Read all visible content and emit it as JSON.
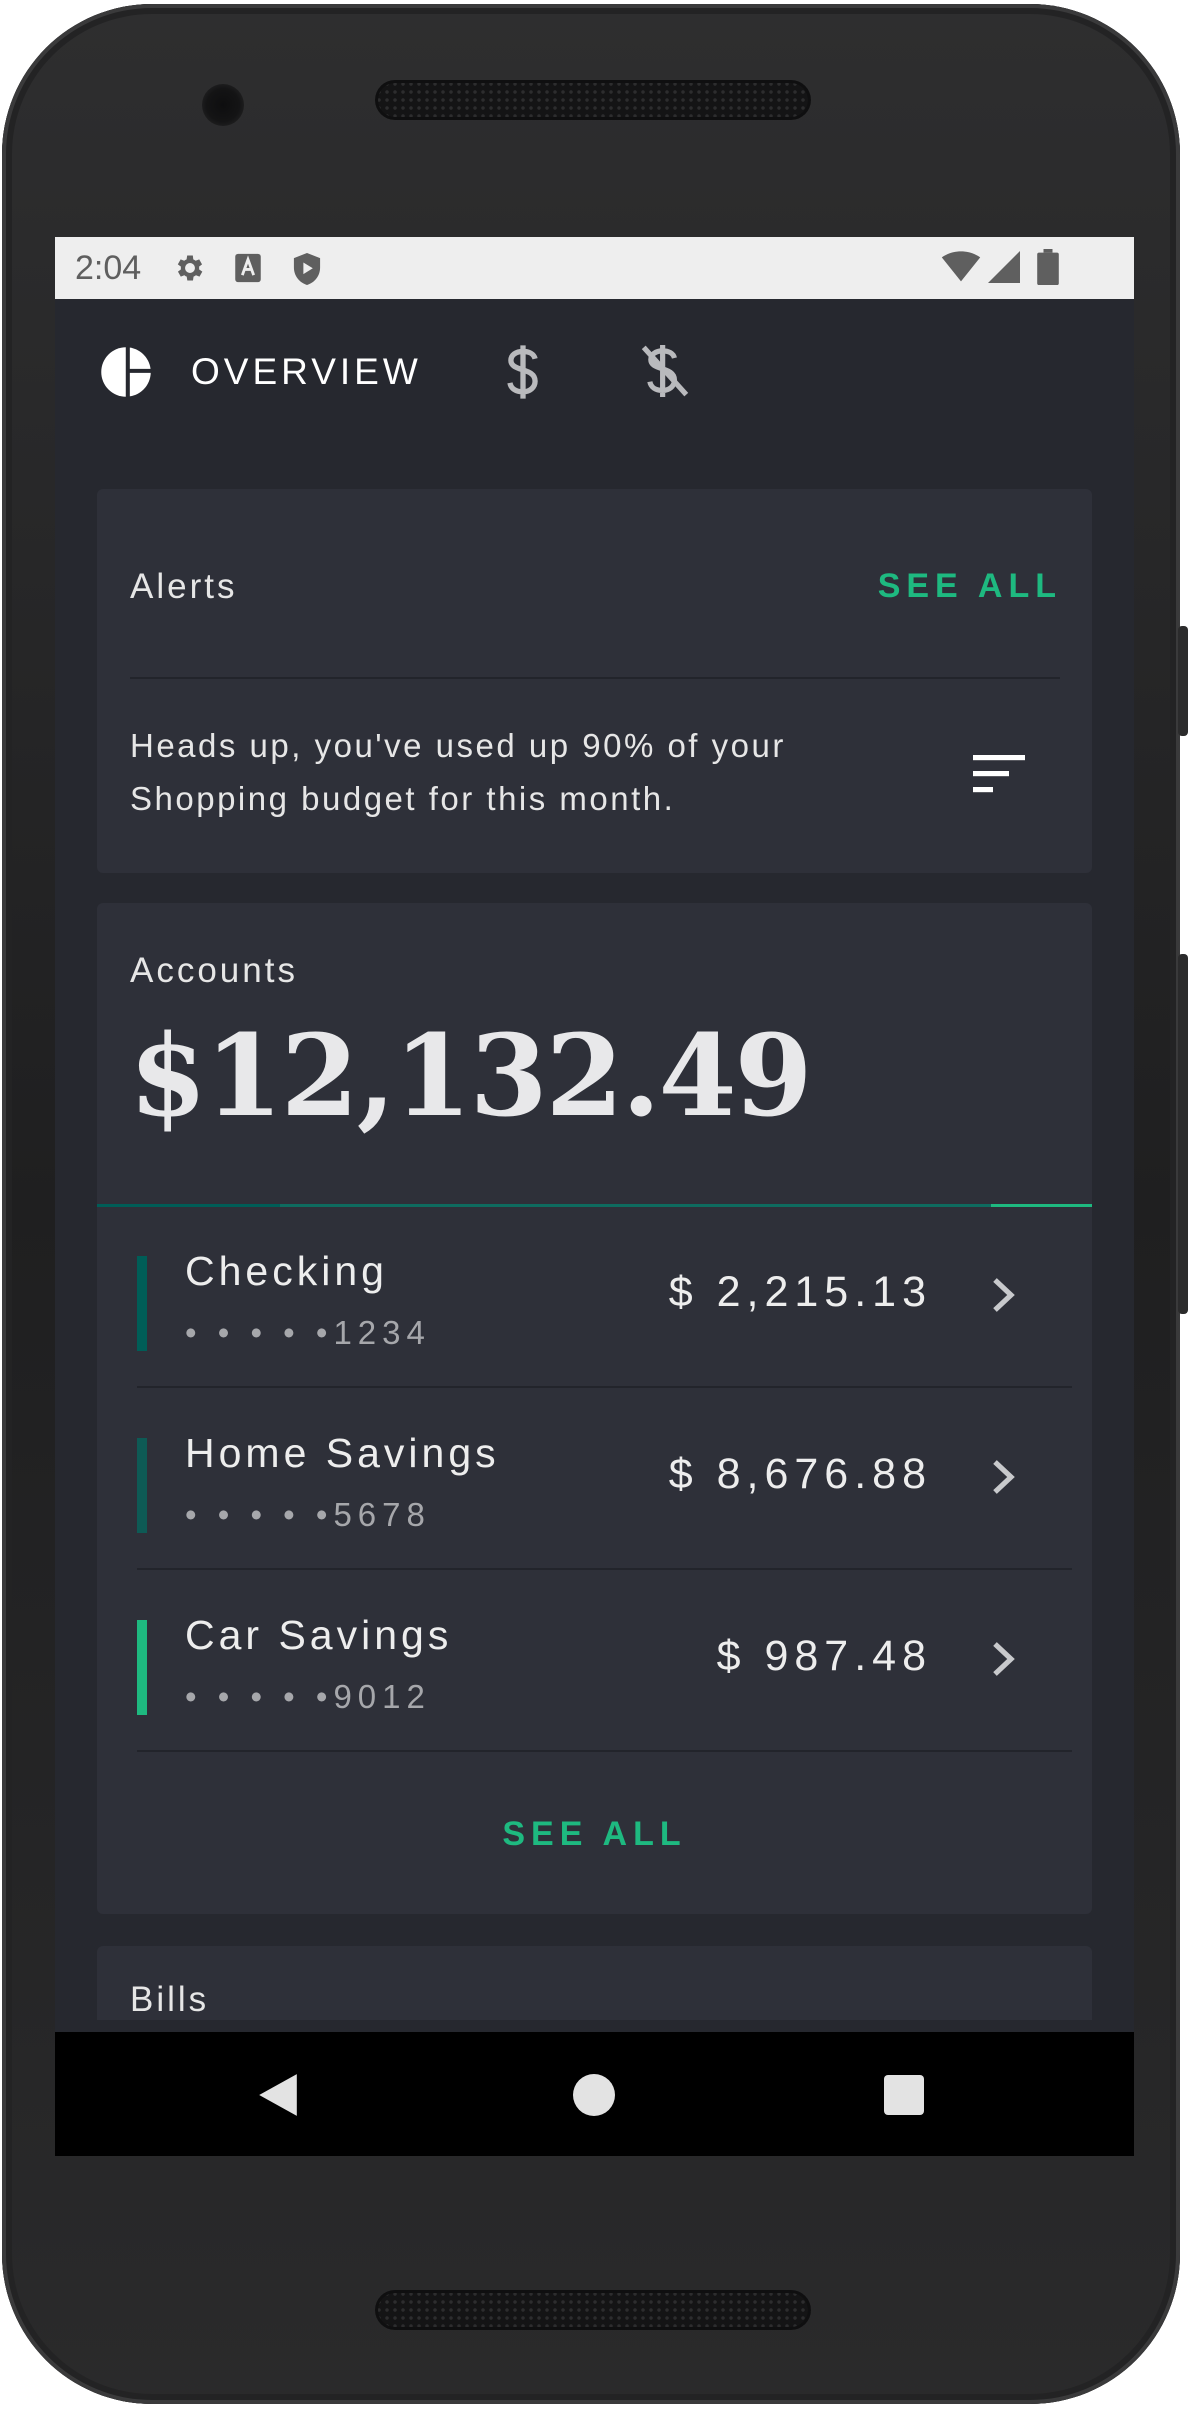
{
  "status_bar": {
    "time": "2:04",
    "left_icons": [
      "gear-icon",
      "a-icon",
      "play-shield-icon"
    ],
    "right_icons": [
      "wifi-icon",
      "signal-icon",
      "battery-icon"
    ]
  },
  "tabs": [
    {
      "label": "OVERVIEW",
      "icon": "pie-chart-icon",
      "selected": true
    },
    {
      "label": "",
      "icon": "dollar-icon",
      "selected": false
    },
    {
      "label": "",
      "icon": "money-off-icon",
      "selected": false
    }
  ],
  "alerts": {
    "title": "Alerts",
    "see_all": "SEE ALL",
    "message": "Heads up, you've used up 90% of your Shopping budget for this month.",
    "action_icon": "sort-icon"
  },
  "accounts": {
    "title": "Accounts",
    "total": "$12,132.49",
    "see_all": "SEE ALL",
    "items": [
      {
        "name": "Checking",
        "number": "• • • • •1234",
        "amount": "$ 2,215.13",
        "color": "#005d57"
      },
      {
        "name": "Home Savings",
        "number": "• • • • •5678",
        "amount": "$ 8,676.88",
        "color": "#04b97f"
      },
      {
        "name": "Car Savings",
        "number": "• • • • •9012",
        "amount": "$ 987.48",
        "color": "#37efba"
      }
    ]
  },
  "bills": {
    "title": "Bills"
  },
  "colors": {
    "background": "#26282f",
    "card": "#2e3039",
    "accent": "#1eb980"
  }
}
